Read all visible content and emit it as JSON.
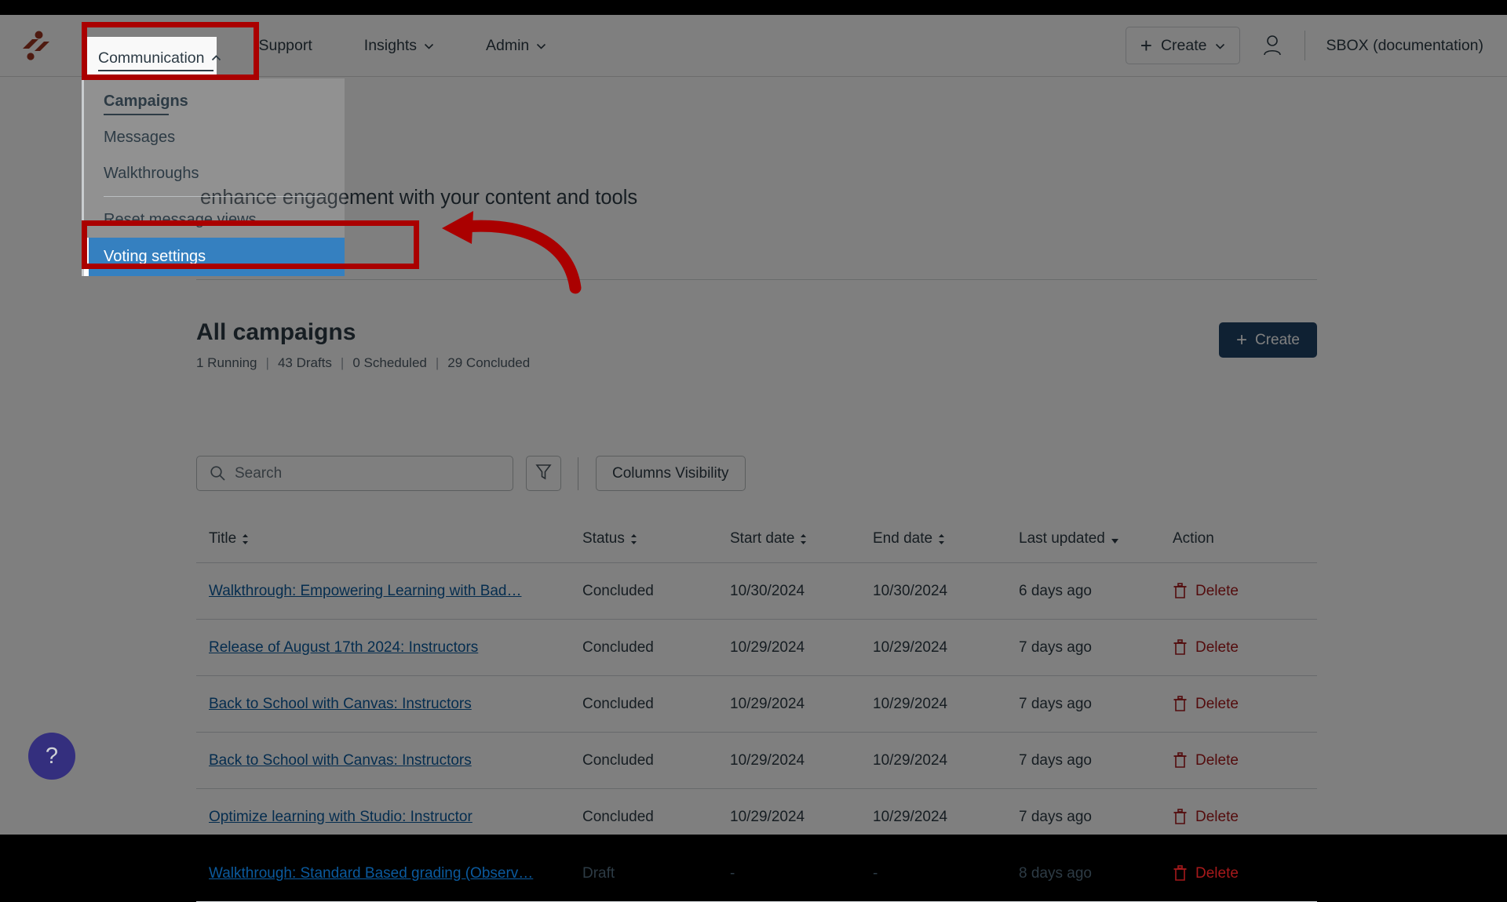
{
  "topnav": {
    "logo_icon": "impact-logo-icon",
    "items": [
      {
        "label": "Communication",
        "icon": "chevron-up-icon",
        "active": true
      },
      {
        "label": "Support",
        "icon": "",
        "active": false
      },
      {
        "label": "Insights",
        "icon": "chevron-down-icon",
        "active": false
      },
      {
        "label": "Admin",
        "icon": "chevron-down-icon",
        "active": false
      }
    ],
    "create_label": "Create",
    "create_plus": "+",
    "create_chevron": "chevron-down-icon",
    "account_icon": "user-account-icon",
    "account_name": "SBOX (documentation)"
  },
  "dropdown": {
    "items": [
      {
        "label": "Campaigns",
        "state": "current"
      },
      {
        "label": "Messages",
        "state": "normal"
      },
      {
        "label": "Walkthroughs",
        "state": "normal"
      },
      {
        "label": "Reset message views",
        "state": "normal"
      },
      {
        "label": "Voting settings",
        "state": "selected"
      }
    ]
  },
  "hero": {
    "subtitle": "enhance engagement with your content and tools"
  },
  "section": {
    "title": "All campaigns",
    "counts": [
      "1 Running",
      "43 Drafts",
      "0 Scheduled",
      "29 Concluded"
    ],
    "count_separator": "|",
    "create_label": "Create",
    "create_plus": "+"
  },
  "toolbar": {
    "search_placeholder": "Search",
    "search_value": "",
    "search_icon": "search-icon",
    "filter_icon": "filter-funnel-icon",
    "columns_label": "Columns Visibility"
  },
  "table": {
    "columns": [
      {
        "label": "Title",
        "sort": "sortable"
      },
      {
        "label": "Status",
        "sort": "sortable"
      },
      {
        "label": "Start date",
        "sort": "sortable"
      },
      {
        "label": "End date",
        "sort": "sortable"
      },
      {
        "label": "Last updated",
        "sort": "sorted-desc"
      },
      {
        "label": "Action",
        "sort": "none"
      }
    ],
    "delete_label": "Delete",
    "delete_icon": "trash-icon",
    "rows": [
      {
        "title": "Walkthrough: Empowering Learning with Bad…",
        "status": "Concluded",
        "start": "10/30/2024",
        "end": "10/30/2024",
        "updated": "6 days ago"
      },
      {
        "title": "Release of August 17th 2024: Instructors",
        "status": "Concluded",
        "start": "10/29/2024",
        "end": "10/29/2024",
        "updated": "7 days ago"
      },
      {
        "title": "Back to School with Canvas: Instructors",
        "status": "Concluded",
        "start": "10/29/2024",
        "end": "10/29/2024",
        "updated": "7 days ago"
      },
      {
        "title": "Back to School with Canvas: Instructors",
        "status": "Concluded",
        "start": "10/29/2024",
        "end": "10/29/2024",
        "updated": "7 days ago"
      },
      {
        "title": "Optimize learning with Studio: Instructor",
        "status": "Concluded",
        "start": "10/29/2024",
        "end": "10/29/2024",
        "updated": "7 days ago"
      },
      {
        "title": "Walkthrough: Standard Based grading (Observ…",
        "status": "Draft",
        "start": "-",
        "end": "-",
        "updated": "8 days ago"
      }
    ]
  },
  "help": {
    "icon": "question-mark-icon",
    "label": "?"
  },
  "annotations": {
    "highlight_color": "#aa0000",
    "selected_item_color": "#3580c0",
    "boxes": [
      "communication-nav-highlight",
      "voting-settings-highlight"
    ],
    "arrow": "pointer-arrow-to-voting-settings"
  }
}
